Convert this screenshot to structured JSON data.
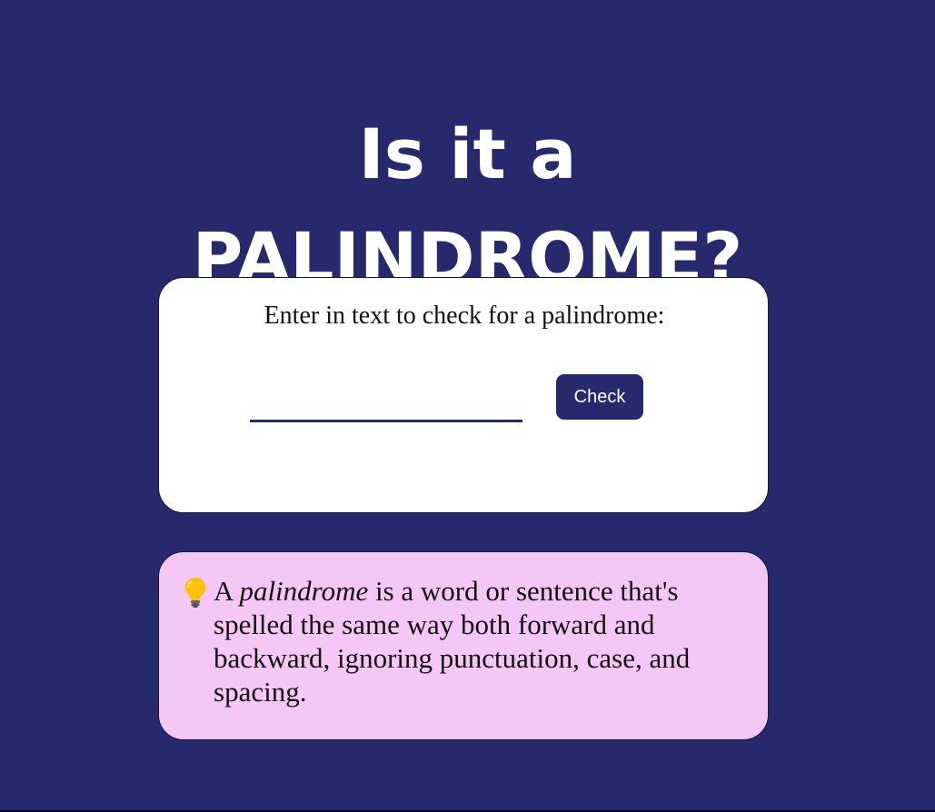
{
  "header": {
    "title_line1": "Is it a",
    "title_line2": "PALINDROME?"
  },
  "checker": {
    "prompt": "Enter in text to check for a palindrome:",
    "input_value": "",
    "button_label": "Check"
  },
  "info": {
    "icon": "lightbulb-icon",
    "intro": "A ",
    "emphasis": "palindrome",
    "rest": " is a word or sentence that's spelled the same way both forward and backward, ignoring punctuation, case, and spacing."
  },
  "colors": {
    "background": "#27296d",
    "card": "#ffffff",
    "info_card": "#f5c7f5",
    "accent": "#27296d",
    "text": "#111111"
  }
}
